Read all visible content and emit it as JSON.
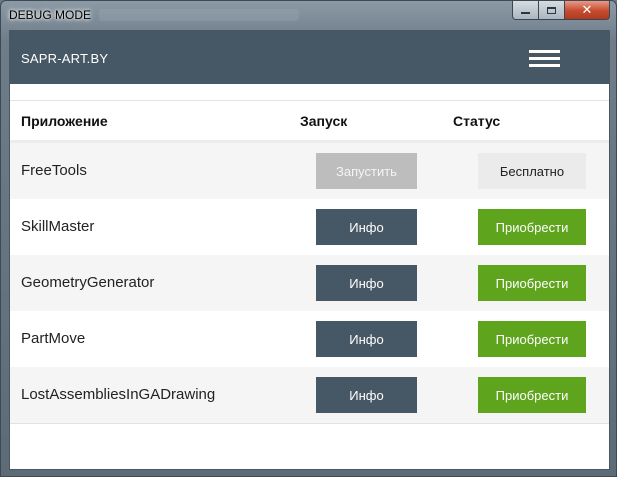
{
  "window": {
    "title": "DEBUG MODE",
    "controls": {
      "minimize": "",
      "maximize": "",
      "close": "✕"
    }
  },
  "header": {
    "brand": "SAPR-ART.BY",
    "menu_icon": "hamburger-menu-icon"
  },
  "table": {
    "columns": {
      "app": "Приложение",
      "launch": "Запуск",
      "status": "Статус"
    },
    "rows": [
      {
        "name": "FreeTools",
        "launch_label": "Запустить",
        "launch_state": "disabled",
        "status_label": "Бесплатно",
        "status_type": "free"
      },
      {
        "name": "SkillMaster",
        "launch_label": "Инфо",
        "launch_state": "info",
        "status_label": "Приобрести",
        "status_type": "buy"
      },
      {
        "name": "GeometryGenerator",
        "launch_label": "Инфо",
        "launch_state": "info",
        "status_label": "Приобрести",
        "status_type": "buy"
      },
      {
        "name": "PartMove",
        "launch_label": "Инфо",
        "launch_state": "info",
        "status_label": "Приобрести",
        "status_type": "buy"
      },
      {
        "name": "LostAssembliesInGADrawing",
        "launch_label": "Инфо",
        "launch_state": "info",
        "status_label": "Приобрести",
        "status_type": "buy"
      }
    ]
  },
  "colors": {
    "header_bg": "#465866",
    "info_button": "#465866",
    "buy_button": "#5ea51d",
    "disabled_button": "#bdbdbd",
    "free_badge": "#ebebeb"
  }
}
